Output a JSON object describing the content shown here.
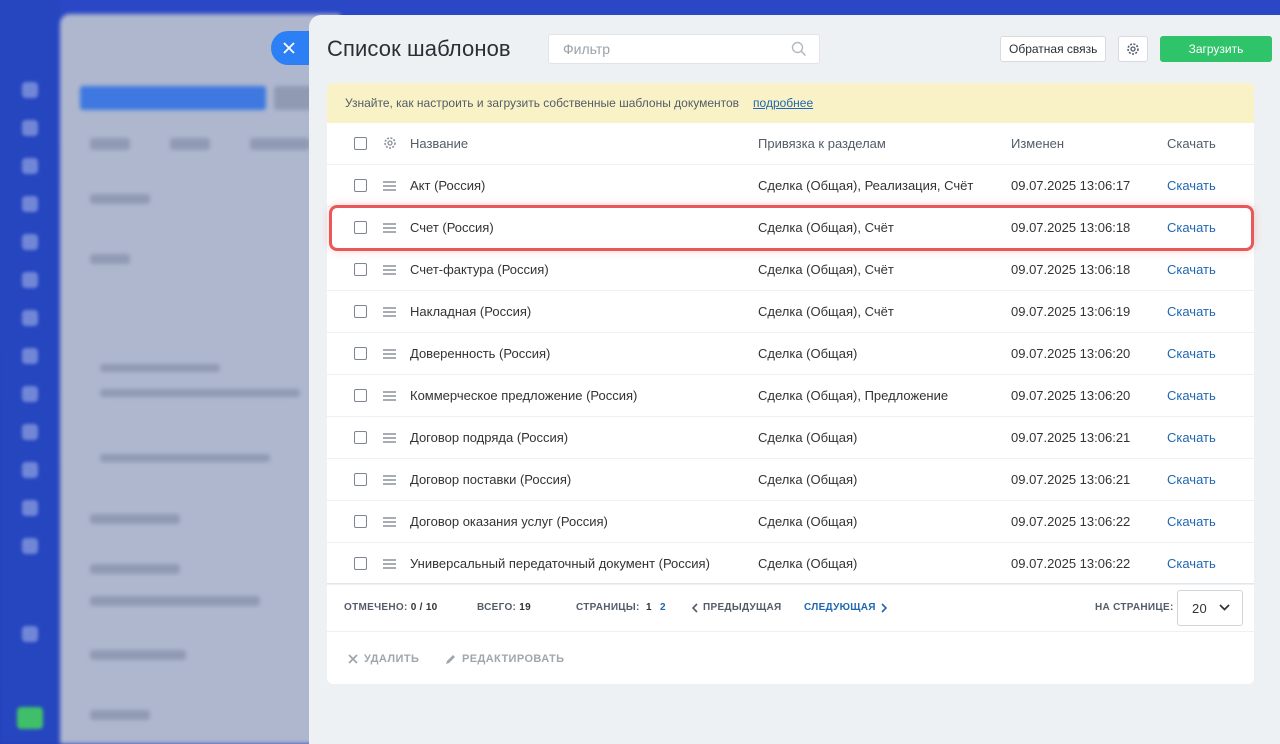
{
  "header": {
    "title": "Список шаблонов",
    "filter_placeholder": "Фильтр",
    "feedback_label": "Обратная связь",
    "upload_label": "Загрузить"
  },
  "notice": {
    "text": "Узнайте, как настроить и загрузить собственные шаблоны документов",
    "link": "подробнее"
  },
  "table": {
    "columns": {
      "name": "Название",
      "binding": "Привязка к разделам",
      "modified": "Изменен",
      "download": "Скачать"
    },
    "rows": [
      {
        "name": "Акт (Россия)",
        "binding": "Сделка (Общая), Реализация, Счёт",
        "modified": "09.07.2025 13:06:17",
        "download": "Скачать"
      },
      {
        "name": "Счет (Россия)",
        "binding": "Сделка (Общая), Счёт",
        "modified": "09.07.2025 13:06:18",
        "download": "Скачать"
      },
      {
        "name": "Счет-фактура (Россия)",
        "binding": "Сделка (Общая), Счёт",
        "modified": "09.07.2025 13:06:18",
        "download": "Скачать"
      },
      {
        "name": "Накладная (Россия)",
        "binding": "Сделка (Общая), Счёт",
        "modified": "09.07.2025 13:06:19",
        "download": "Скачать"
      },
      {
        "name": "Доверенность (Россия)",
        "binding": "Сделка (Общая)",
        "modified": "09.07.2025 13:06:20",
        "download": "Скачать"
      },
      {
        "name": "Коммерческое предложение (Россия)",
        "binding": "Сделка (Общая), Предложение",
        "modified": "09.07.2025 13:06:20",
        "download": "Скачать"
      },
      {
        "name": "Договор подряда (Россия)",
        "binding": "Сделка (Общая)",
        "modified": "09.07.2025 13:06:21",
        "download": "Скачать"
      },
      {
        "name": "Договор поставки (Россия)",
        "binding": "Сделка (Общая)",
        "modified": "09.07.2025 13:06:21",
        "download": "Скачать"
      },
      {
        "name": "Договор оказания услуг (Россия)",
        "binding": "Сделка (Общая)",
        "modified": "09.07.2025 13:06:22",
        "download": "Скачать"
      },
      {
        "name": "Универсальный передаточный документ (Россия)",
        "binding": "Сделка (Общая)",
        "modified": "09.07.2025 13:06:22",
        "download": "Скачать"
      }
    ],
    "highlighted_row_index": 1
  },
  "footer": {
    "checked_label": "ОТМЕЧЕНО:",
    "checked_value": "0 / 10",
    "total_label": "ВСЕГО:",
    "total_value": "19",
    "pages_label": "СТРАНИЦЫ:",
    "page_1": "1",
    "page_2": "2",
    "prev_label": "ПРЕДЫДУЩАЯ",
    "next_label": "СЛЕДУЮЩАЯ",
    "per_page_label": "НА СТРАНИЦЕ:",
    "per_page_value": "20"
  },
  "actions": {
    "delete_label": "УДАЛИТЬ",
    "edit_label": "РЕДАКТИРОВАТЬ"
  },
  "colors": {
    "accent_green": "#2fc36a",
    "link_blue": "#2067b0",
    "highlight_red": "#e85858",
    "notice_yellow": "#f8f2c6",
    "close_tab_blue": "#2d7ff5"
  },
  "icons": [
    "close-icon",
    "search-icon",
    "gear-icon",
    "drag-handle-icon",
    "chevron-left-icon",
    "chevron-right-icon",
    "chevron-down-icon",
    "delete-x-icon",
    "pencil-icon"
  ]
}
